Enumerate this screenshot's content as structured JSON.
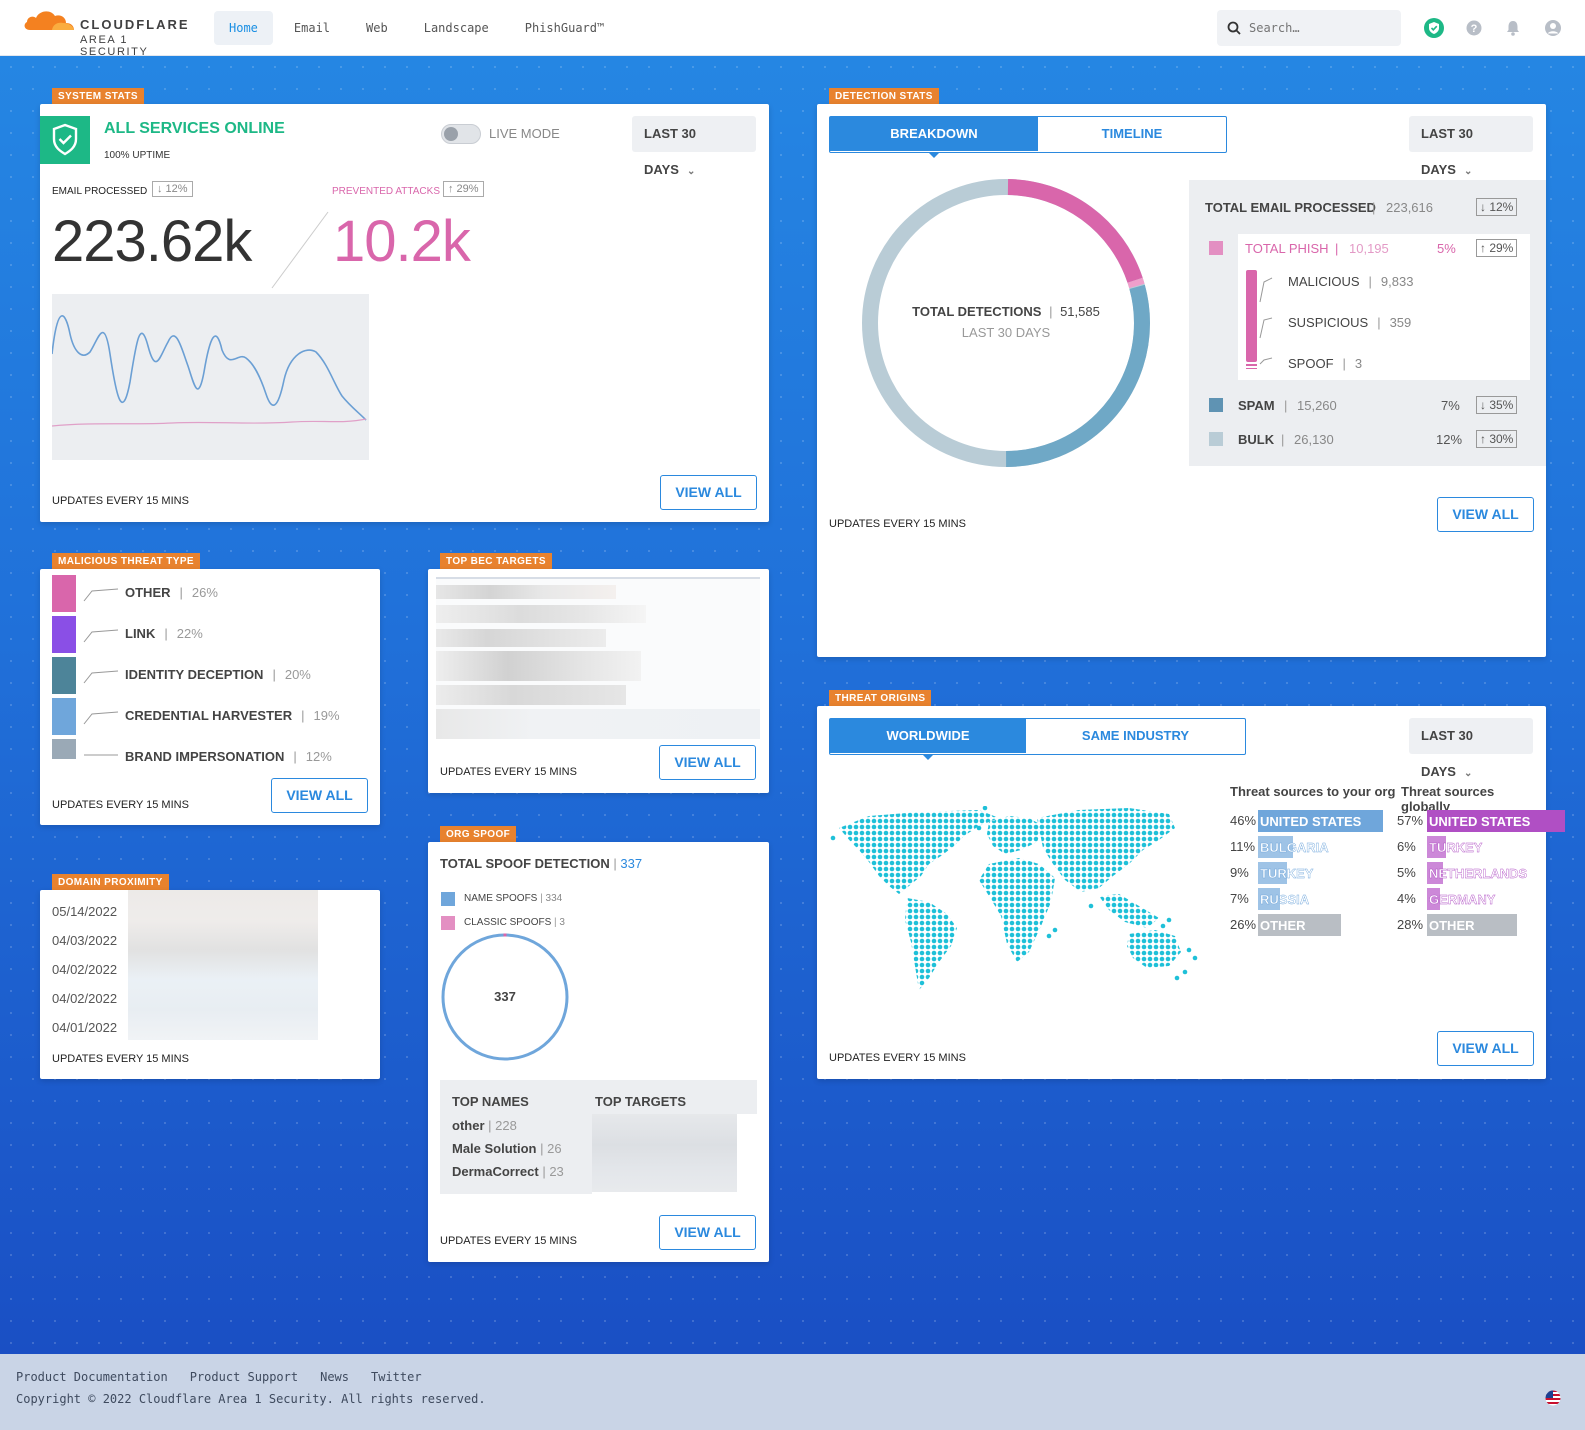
{
  "brand": {
    "name": "CLOUDFLARE",
    "sub": "AREA 1 SECURITY"
  },
  "nav": {
    "tabs": [
      "Home",
      "Email",
      "Web",
      "Landscape",
      "PhishGuard™"
    ],
    "active": "Home"
  },
  "search": {
    "placeholder": "Search…"
  },
  "icons": {
    "shield": "shield-check-icon",
    "help": "help-icon",
    "bell": "bell-icon",
    "user": "user-icon",
    "flag": "us-flag-icon"
  },
  "colors": {
    "accent": "#2b89de",
    "orange": "#e8822e",
    "phish": "#d966ab",
    "green": "#1db886",
    "spam": "#6fa8c6",
    "bulk": "#b9ccd6"
  },
  "system_stats": {
    "tag": "SYSTEM STATS",
    "status": "ALL SERVICES ONLINE",
    "uptime": "100% UPTIME",
    "live_mode": "LIVE MODE",
    "live_mode_on": false,
    "range": "LAST 30 DAYS",
    "email_label": "EMAIL PROCESSED",
    "email_change": "↓ 12%",
    "email_value": "223.62k",
    "attacks_label": "PREVENTED ATTACKS",
    "attacks_change": "↑ 29%",
    "attacks_value": "10.2k",
    "updates": "UPDATES EVERY 15 MINS",
    "view_all": "VIEW ALL"
  },
  "detection_stats": {
    "tag": "DETECTION STATS",
    "tabs": [
      "BREAKDOWN",
      "TIMELINE"
    ],
    "range": "LAST 30 DAYS",
    "center_label": "TOTAL DETECTIONS",
    "center_value": "51,585",
    "center_sub": "LAST 30 DAYS",
    "total_label": "TOTAL EMAIL PROCESSED",
    "total_value": "223,616",
    "total_change": "↓ 12%",
    "phish": {
      "label": "TOTAL PHISH",
      "value": "10,195",
      "pct": "5%",
      "change": "↑ 29%"
    },
    "phish_sub": [
      {
        "label": "MALICIOUS",
        "value": "9,833"
      },
      {
        "label": "SUSPICIOUS",
        "value": "359"
      },
      {
        "label": "SPOOF",
        "value": "3"
      }
    ],
    "spam": {
      "label": "SPAM",
      "value": "15,260",
      "pct": "7%",
      "change": "↓ 35%"
    },
    "bulk": {
      "label": "BULK",
      "value": "26,130",
      "pct": "12%",
      "change": "↑ 30%"
    },
    "updates": "UPDATES EVERY 15 MINS",
    "view_all": "VIEW ALL"
  },
  "threat_type": {
    "tag": "MALICIOUS THREAT TYPE",
    "items": [
      {
        "label": "OTHER",
        "pct": "26%",
        "color": "#d966ab"
      },
      {
        "label": "LINK",
        "pct": "22%",
        "color": "#8a4fe6"
      },
      {
        "label": "IDENTITY DECEPTION",
        "pct": "20%",
        "color": "#4d8499"
      },
      {
        "label": "CREDENTIAL HARVESTER",
        "pct": "19%",
        "color": "#6fa6db"
      },
      {
        "label": "BRAND IMPERSONATION",
        "pct": "12%",
        "color": "#9aa9b6"
      }
    ],
    "updates": "UPDATES EVERY 15 MINS",
    "view_all": "VIEW ALL"
  },
  "bec_targets": {
    "tag": "TOP BEC TARGETS",
    "updates": "UPDATES EVERY 15 MINS",
    "view_all": "VIEW ALL"
  },
  "domain_proximity": {
    "tag": "DOMAIN PROXIMITY",
    "dates": [
      "05/14/2022",
      "04/03/2022",
      "04/02/2022",
      "04/02/2022",
      "04/01/2022"
    ],
    "updates": "UPDATES EVERY 15 MINS"
  },
  "org_spoof": {
    "tag": "ORG SPOOF",
    "title": "TOTAL SPOOF DETECTION",
    "total": "337",
    "name_spoofs_label": "NAME SPOOFS",
    "name_spoofs": "334",
    "classic_spoofs_label": "CLASSIC SPOOFS",
    "classic_spoofs": "3",
    "center": "337",
    "names_header": "TOP NAMES",
    "targets_header": "TOP TARGETS",
    "names": [
      {
        "name": "other",
        "count": "228"
      },
      {
        "name": "Male Solution",
        "count": "26"
      },
      {
        "name": "DermaCorrect",
        "count": "23"
      }
    ],
    "updates": "UPDATES EVERY 15 MINS",
    "view_all": "VIEW ALL"
  },
  "threat_origins": {
    "tag": "THREAT ORIGINS",
    "tabs": [
      "WORLDWIDE",
      "SAME INDUSTRY"
    ],
    "range": "LAST 30 DAYS",
    "org_header": "Threat sources to your org",
    "global_header": "Threat sources globally",
    "org": [
      {
        "pct": "46%",
        "country": "UNITED STATES"
      },
      {
        "pct": "11%",
        "country": "BULGARIA"
      },
      {
        "pct": "9%",
        "country": "TURKEY"
      },
      {
        "pct": "7%",
        "country": "RUSSIA"
      },
      {
        "pct": "26%",
        "country": "OTHER"
      }
    ],
    "global": [
      {
        "pct": "57%",
        "country": "UNITED STATES"
      },
      {
        "pct": "6%",
        "country": "TURKEY"
      },
      {
        "pct": "5%",
        "country": "NETHERLANDS"
      },
      {
        "pct": "4%",
        "country": "GERMANY"
      },
      {
        "pct": "28%",
        "country": "OTHER"
      }
    ],
    "updates": "UPDATES EVERY 15 MINS",
    "view_all": "VIEW ALL"
  },
  "footer": {
    "links": [
      "Product Documentation",
      "Product Support",
      "News",
      "Twitter"
    ],
    "copyright": "Copyright © 2022 Cloudflare Area 1 Security. All rights reserved."
  }
}
